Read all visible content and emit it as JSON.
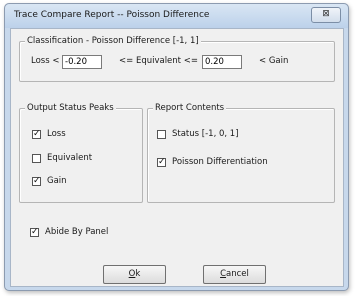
{
  "window": {
    "title": "Trace Compare Report -- Poisson Difference",
    "close_glyph": "⊠"
  },
  "classification": {
    "legend": "Classification - Poisson Difference [-1, 1]",
    "loss_label": "Loss <",
    "loss_value": "-0.20",
    "equiv_label": "<= Equivalent <=",
    "equiv_value": "0.20",
    "gain_label": "< Gain"
  },
  "output_status": {
    "legend": "Output Status Peaks",
    "items": [
      {
        "label": "Loss",
        "checked": true
      },
      {
        "label": "Equivalent",
        "checked": false
      },
      {
        "label": "Gain",
        "checked": true
      }
    ]
  },
  "report_contents": {
    "legend": "Report Contents",
    "items": [
      {
        "label": "Status [-1, 0, 1]",
        "checked": false
      },
      {
        "label": "Poisson Differentiation",
        "checked": true
      }
    ]
  },
  "abide": {
    "label": "Abide By Panel",
    "checked": true
  },
  "buttons": {
    "ok": {
      "mnemonic": "O",
      "rest": "k"
    },
    "cancel": {
      "mnemonic": "C",
      "rest": "ancel"
    }
  },
  "check_glyph": "✓"
}
